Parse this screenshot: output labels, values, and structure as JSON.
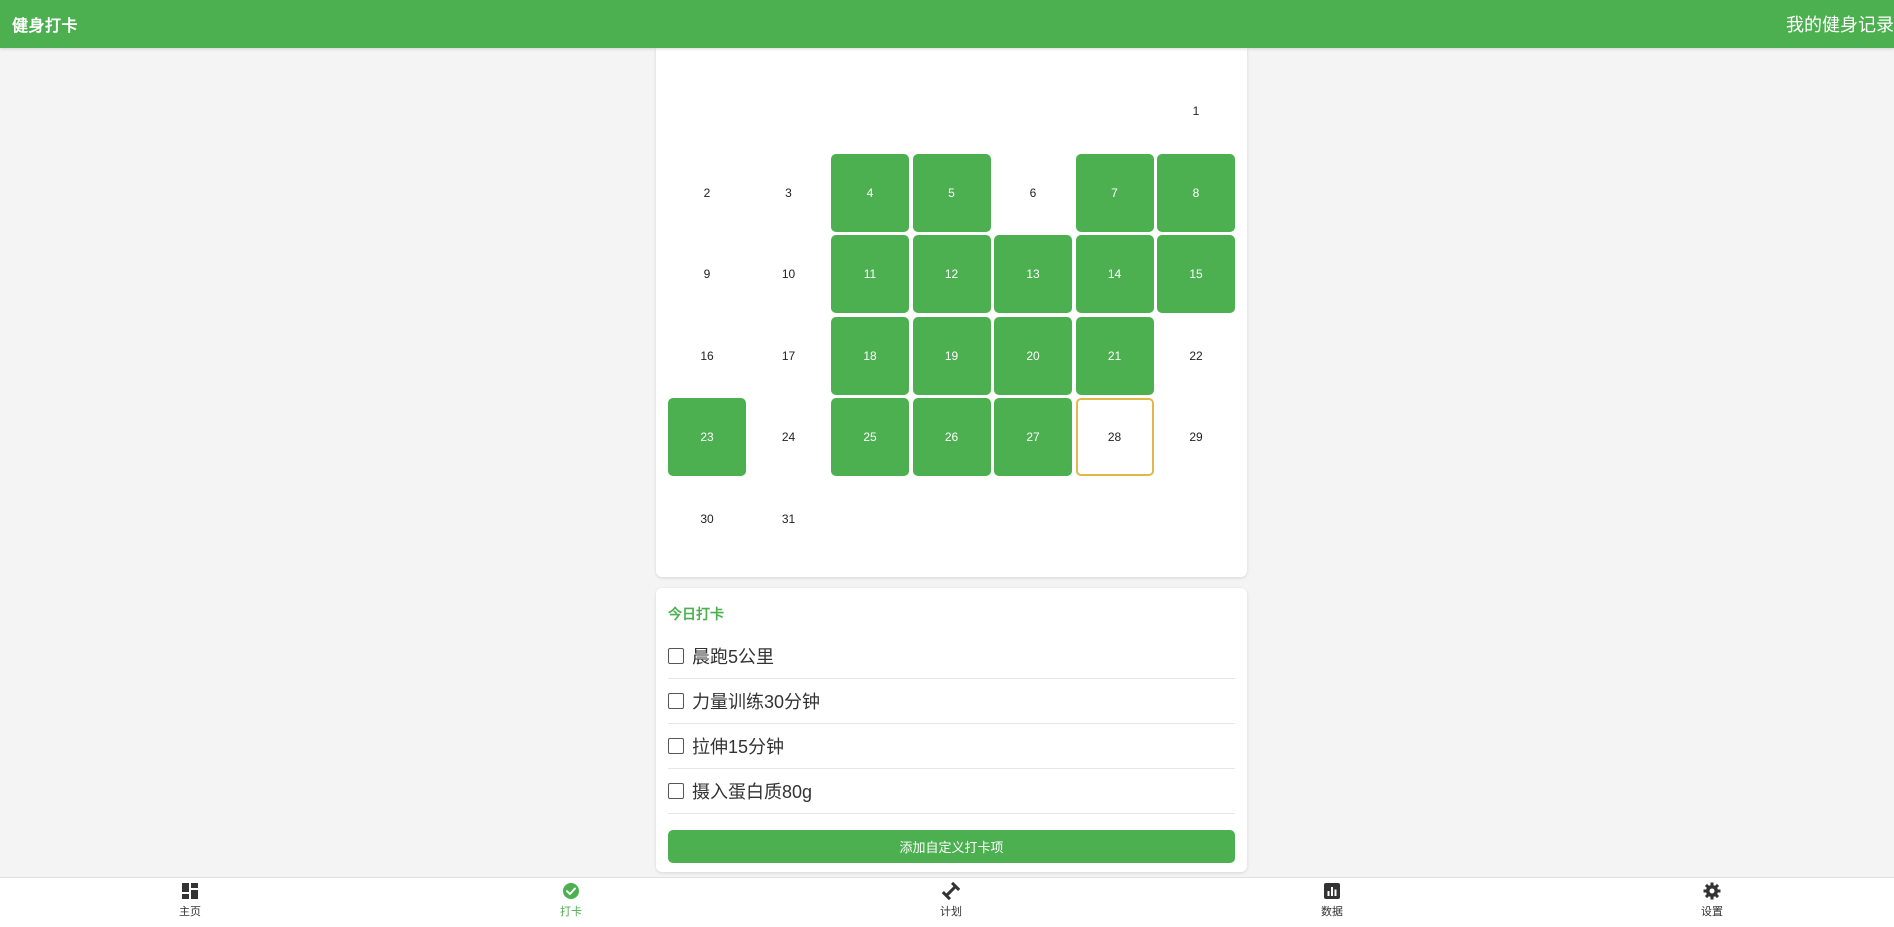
{
  "header": {
    "title": "健身打卡",
    "right_text": "我的健身记录"
  },
  "calendar": {
    "leading_blanks": 6,
    "days": [
      {
        "day": "1",
        "checked": false,
        "today": false
      },
      {
        "day": "2",
        "checked": false,
        "today": false
      },
      {
        "day": "3",
        "checked": false,
        "today": false
      },
      {
        "day": "4",
        "checked": true,
        "today": false
      },
      {
        "day": "5",
        "checked": true,
        "today": false
      },
      {
        "day": "6",
        "checked": false,
        "today": false
      },
      {
        "day": "7",
        "checked": true,
        "today": false
      },
      {
        "day": "8",
        "checked": true,
        "today": false
      },
      {
        "day": "9",
        "checked": false,
        "today": false
      },
      {
        "day": "10",
        "checked": false,
        "today": false
      },
      {
        "day": "11",
        "checked": true,
        "today": false
      },
      {
        "day": "12",
        "checked": true,
        "today": false
      },
      {
        "day": "13",
        "checked": true,
        "today": false
      },
      {
        "day": "14",
        "checked": true,
        "today": false
      },
      {
        "day": "15",
        "checked": true,
        "today": false
      },
      {
        "day": "16",
        "checked": false,
        "today": false
      },
      {
        "day": "17",
        "checked": false,
        "today": false
      },
      {
        "day": "18",
        "checked": true,
        "today": false
      },
      {
        "day": "19",
        "checked": true,
        "today": false
      },
      {
        "day": "20",
        "checked": true,
        "today": false
      },
      {
        "day": "21",
        "checked": true,
        "today": false
      },
      {
        "day": "22",
        "checked": false,
        "today": false
      },
      {
        "day": "23",
        "checked": true,
        "today": false
      },
      {
        "day": "24",
        "checked": false,
        "today": false
      },
      {
        "day": "25",
        "checked": true,
        "today": false
      },
      {
        "day": "26",
        "checked": true,
        "today": false
      },
      {
        "day": "27",
        "checked": true,
        "today": false
      },
      {
        "day": "28",
        "checked": false,
        "today": true
      },
      {
        "day": "29",
        "checked": false,
        "today": false
      },
      {
        "day": "30",
        "checked": false,
        "today": false
      },
      {
        "day": "31",
        "checked": false,
        "today": false
      }
    ]
  },
  "checkin": {
    "title": "今日打卡",
    "tasks": [
      {
        "label": "晨跑5公里",
        "checked": false
      },
      {
        "label": "力量训练30分钟",
        "checked": false
      },
      {
        "label": "拉伸15分钟",
        "checked": false
      },
      {
        "label": "摄入蛋白质80g",
        "checked": false
      }
    ],
    "add_button_label": "添加自定义打卡项"
  },
  "nav": {
    "items": [
      {
        "label": "主页",
        "icon": "dashboard-icon",
        "active": false
      },
      {
        "label": "打卡",
        "icon": "check-circle-icon",
        "active": true
      },
      {
        "label": "计划",
        "icon": "fitness-icon",
        "active": false
      },
      {
        "label": "数据",
        "icon": "bar-chart-icon",
        "active": false
      },
      {
        "label": "设置",
        "icon": "gear-icon",
        "active": false
      }
    ]
  },
  "colors": {
    "accent": "#4caf50",
    "today_border": "#e0b84a"
  }
}
